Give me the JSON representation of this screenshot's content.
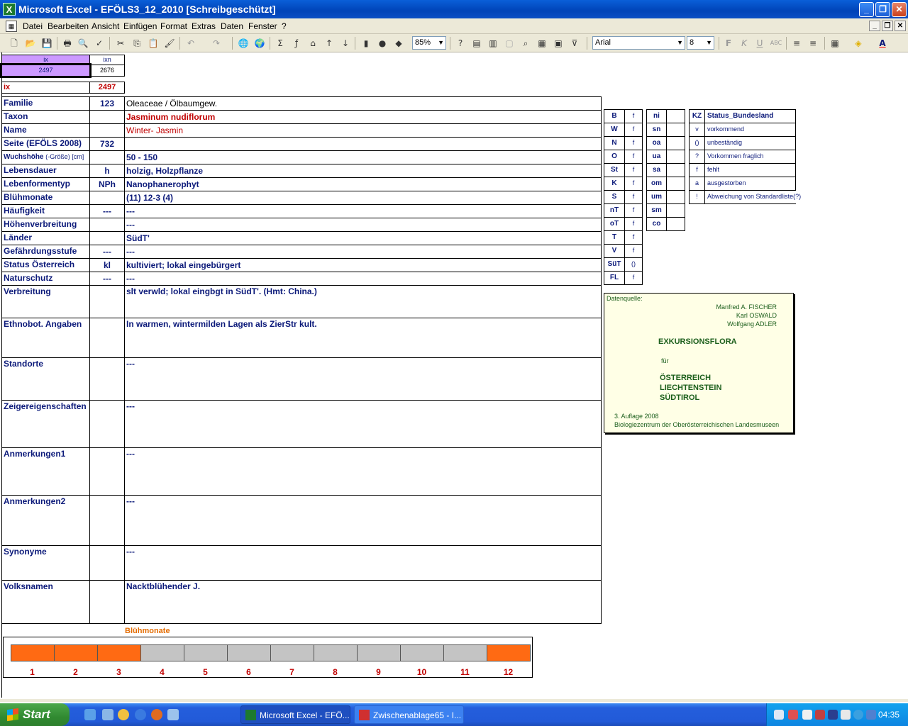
{
  "window": {
    "title": "Microsoft Excel - EFÖLS3_12_2010  [Schreibgeschützt]"
  },
  "menu": [
    "Datei",
    "Bearbeiten",
    "Ansicht",
    "Einfügen",
    "Format",
    "Extras",
    "Daten",
    "Fenster",
    "?"
  ],
  "toolbar": {
    "zoom": "85%",
    "font": "Arial",
    "size": "8"
  },
  "index": {
    "ix_header": "ix",
    "ixn_header": "ixn",
    "ix_value": "2497",
    "ixn_value": "2676",
    "ix_label": "ix",
    "ix_red": "2497"
  },
  "rows": [
    {
      "label": "Familie",
      "code": "123",
      "value": "Oleaceae  /  Ölbaumgew.",
      "style": "normal"
    },
    {
      "label": "Taxon",
      "code": "",
      "value": "Jasminum nudiflorum",
      "style": "redbold"
    },
    {
      "label": "Name",
      "code": "",
      "value": "Winter- Jasmin",
      "style": "red"
    },
    {
      "label": "Seite (EFÖLS 2008)",
      "code": "732",
      "value": "",
      "style": "bold"
    },
    {
      "label": "Wuchshöhe",
      "label_suffix": "(-Größe) [cm]",
      "code": "",
      "value": " 50 - 150",
      "style": "bold"
    },
    {
      "label": "Lebensdauer",
      "code": "h",
      "value": "holzig, Holzpflanze",
      "style": "bold"
    },
    {
      "label": "Lebenformentyp",
      "code": "NPh",
      "value": "Nanophanerophyt",
      "style": "bold"
    },
    {
      "label": "Blühmonate",
      "code": "",
      "value": "(11) 12-3 (4)",
      "style": "bold"
    },
    {
      "label": "Häufigkeit",
      "code": "---",
      "value": " ---",
      "style": "bold"
    },
    {
      "label": "Höhenverbreitung",
      "code": "",
      "value": " ---",
      "style": "bold"
    },
    {
      "label": "Länder",
      "code": "",
      "value": "SüdT'",
      "style": "bold"
    },
    {
      "label": "Gefährdungsstufe",
      "code": "---",
      "value": "   ---",
      "style": "bold"
    },
    {
      "label": "Status Österreich",
      "code": "kl",
      "value": "kultiviert; lokal eingebürgert",
      "style": "bold"
    },
    {
      "label": "Naturschutz",
      "code": "---",
      "value": " ---",
      "style": "bold"
    }
  ],
  "big_rows": [
    {
      "label": "Verbreitung",
      "value": "slt verwld; lokal eingbgt in SüdT'. (Hmt: China.)"
    },
    {
      "label": "Ethnobot. Angaben",
      "value": "In warmen, wintermilden Lagen als ZierStr kult."
    },
    {
      "label": "Standorte",
      "value": "---"
    },
    {
      "label": "Zeigereigenschaften",
      "value": "---"
    },
    {
      "label": "Anmerkungen1",
      "value": "---"
    },
    {
      "label": "Anmerkungen2",
      "value": "---"
    },
    {
      "label": "Synonyme",
      "value": "---"
    },
    {
      "label": "Volksnamen",
      "value": "Nacktblühender J."
    }
  ],
  "legend_a": [
    {
      "k": "B",
      "v": "f"
    },
    {
      "k": "W",
      "v": "f"
    },
    {
      "k": "N",
      "v": "f"
    },
    {
      "k": "O",
      "v": "f"
    },
    {
      "k": "St",
      "v": "f"
    },
    {
      "k": "K",
      "v": "f"
    },
    {
      "k": "S",
      "v": "f"
    },
    {
      "k": "nT",
      "v": "f"
    },
    {
      "k": "oT",
      "v": "f"
    },
    {
      "k": "T",
      "v": "f"
    },
    {
      "k": "V",
      "v": "f"
    },
    {
      "k": "SüT",
      "v": "()"
    },
    {
      "k": "FL",
      "v": "f"
    }
  ],
  "legend_b": [
    "ni",
    "sn",
    "oa",
    "ua",
    "sa",
    "om",
    "um",
    "sm",
    "co"
  ],
  "legend_c": {
    "header_kz": "KZ",
    "header_status": "Status_Bundesland",
    "items": [
      {
        "k": "v",
        "v": "vorkommend"
      },
      {
        "k": "()",
        "v": "unbeständig"
      },
      {
        "k": "?",
        "v": "Vorkommen fraglich"
      },
      {
        "k": "f",
        "v": "fehlt"
      },
      {
        "k": "a",
        "v": "ausgestorben"
      },
      {
        "k": "!",
        "v": "Abweichung von Standardliste(?)"
      }
    ]
  },
  "source": {
    "label": "Datenquelle:",
    "author1": "Manfred A. FISCHER",
    "author2": "Karl OSWALD",
    "author3": "Wolfgang ADLER",
    "title": "EXKURSIONSFLORA",
    "fuer": "für",
    "region1": "ÖSTERREICH",
    "region2": "LIECHTENSTEIN",
    "region3": "SÜDTIROL",
    "edition": "3. Auflage 2008",
    "publisher": "Biologiezentrum der Oberösterreichischen Landesmuseen"
  },
  "bloom": {
    "title": "Blühmonate",
    "months": [
      "1",
      "2",
      "3",
      "4",
      "5",
      "6",
      "7",
      "8",
      "9",
      "10",
      "11",
      "12"
    ],
    "active": [
      true,
      true,
      true,
      false,
      false,
      false,
      false,
      false,
      false,
      false,
      false,
      true
    ],
    "active_color": "#ff6a13",
    "inactive_color": "#c4c4c4"
  },
  "taskbar": {
    "start": "Start",
    "task1": "Microsoft Excel - EFÖ...",
    "task2": "Zwischenablage65 - I...",
    "clock": "04:35"
  }
}
